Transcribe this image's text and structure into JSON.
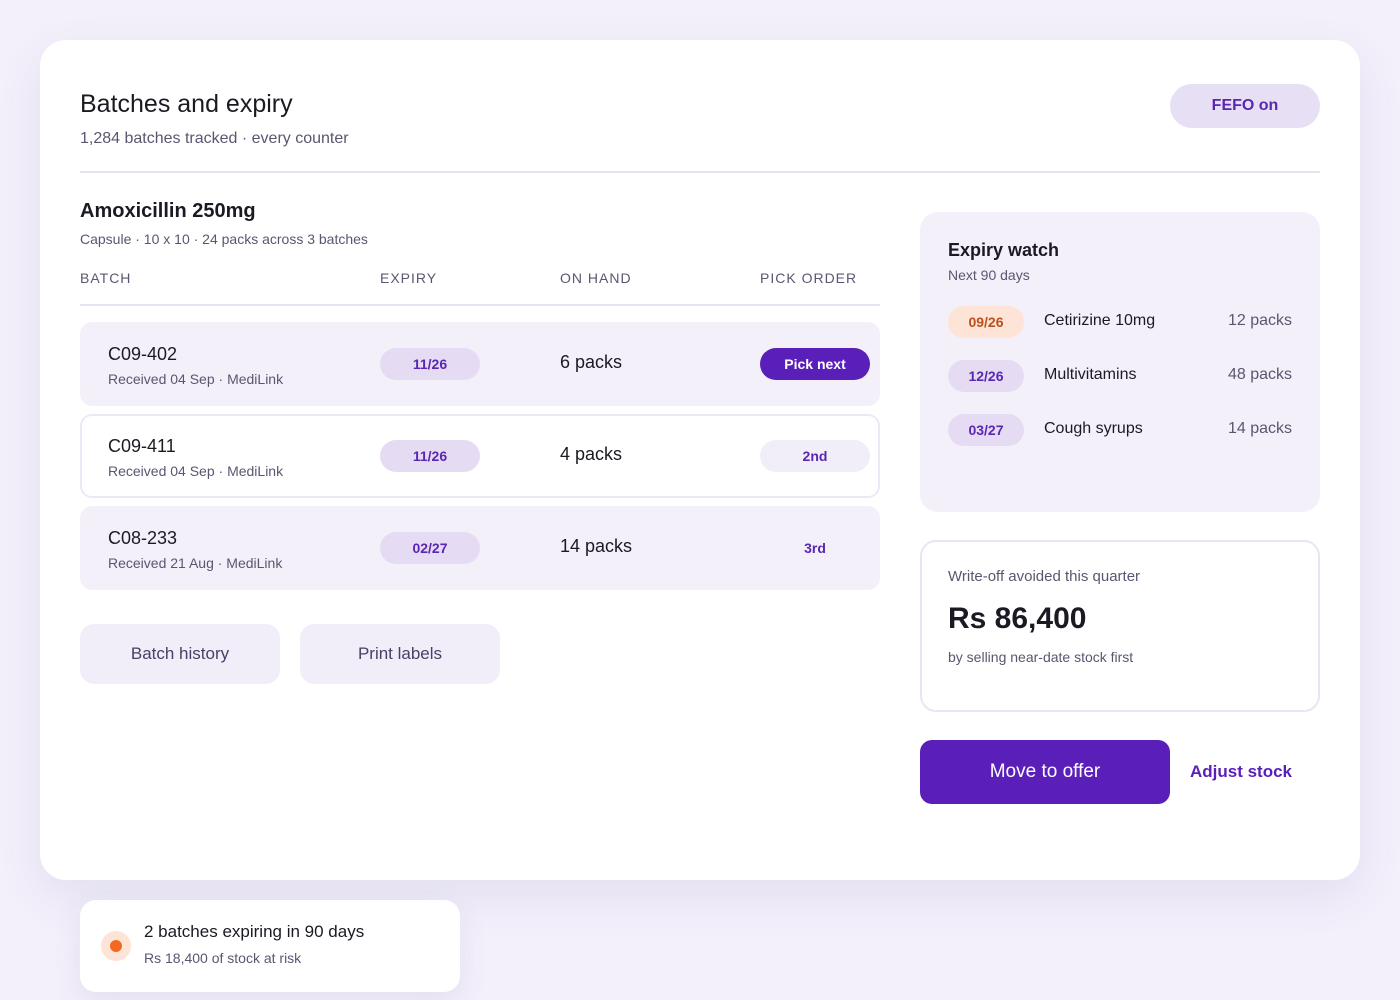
{
  "header": {
    "title": "Batches and expiry",
    "subtitle": "1,284 batches tracked · every counter",
    "fefo_label": "FEFO on"
  },
  "product": {
    "name": "Amoxicillin 250mg",
    "meta": "Capsule · 10 x 10 · 24 packs across 3 batches"
  },
  "table": {
    "columns": [
      "BATCH",
      "EXPIRY",
      "ON HAND",
      "PICK ORDER"
    ],
    "rows": [
      {
        "batch": "C09-402",
        "received": "Received 04 Sep · MediLink",
        "expiry": "11/26",
        "on_hand": "6 packs",
        "pick": "Pick next"
      },
      {
        "batch": "C09-411",
        "received": "Received 04 Sep · MediLink",
        "expiry": "11/26",
        "on_hand": "4 packs",
        "pick": "2nd"
      },
      {
        "batch": "C08-233",
        "received": "Received 21 Aug · MediLink",
        "expiry": "02/27",
        "on_hand": "14 packs",
        "pick": "3rd"
      }
    ]
  },
  "actions": {
    "batch_history": "Batch history",
    "print_labels": "Print labels"
  },
  "expiry_watch": {
    "title": "Expiry watch",
    "subtitle": "Next 90 days",
    "items": [
      {
        "date": "09/26",
        "name": "Cetirizine 10mg",
        "qty": "12 packs"
      },
      {
        "date": "12/26",
        "name": "Multivitamins",
        "qty": "48 packs"
      },
      {
        "date": "03/27",
        "name": "Cough syrups",
        "qty": "14 packs"
      }
    ]
  },
  "writeoff": {
    "label": "Write-off avoided this quarter",
    "value": "Rs 86,400",
    "note": "by selling near-date stock first"
  },
  "buttons": {
    "move_to_offer": "Move to offer",
    "adjust_stock": "Adjust stock"
  },
  "toast": {
    "title": "2 batches expiring in 90 days",
    "subtitle": "Rs 18,400 of stock at risk"
  },
  "colors": {
    "accent": "#5a1fb8",
    "pill_soft": "#e5dcf4",
    "warning_bg": "#fde4d6",
    "warning_text": "#b9501d",
    "warning_dot": "#f26a1f"
  }
}
